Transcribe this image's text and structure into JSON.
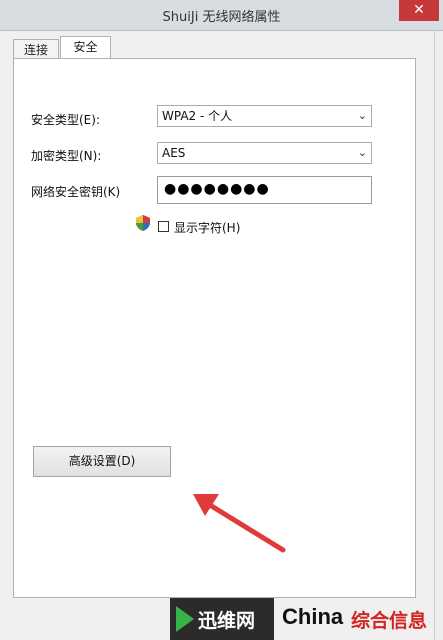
{
  "window": {
    "title": "ShuiJi 无线网络属性",
    "close_icon": "close-icon"
  },
  "tabs": [
    {
      "label": "连接",
      "active": false
    },
    {
      "label": "安全",
      "active": true
    }
  ],
  "security": {
    "type_label": "安全类型(E):",
    "type_value": "WPA2 - 个人",
    "encryption_label": "加密类型(N):",
    "encryption_value": "AES",
    "key_label": "网络安全密钥(K)",
    "key_value": "●●●●●●●●",
    "show_chars_label": "显示字符(H)",
    "show_chars_checked": false,
    "shield_icon": "uac-shield-icon"
  },
  "advanced_button": "高级设置(D)",
  "annotation": {
    "arrow_color": "#e03a3a"
  },
  "watermark": {
    "brand_cn": "迅维网",
    "brand_en": "China",
    "brand_info": "综合信息"
  }
}
